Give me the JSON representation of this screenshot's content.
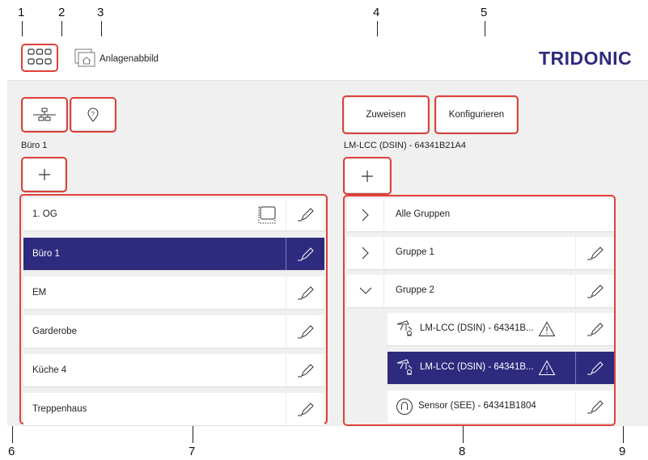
{
  "callouts": [
    "1",
    "2",
    "3",
    "4",
    "5",
    "6",
    "7",
    "8",
    "9"
  ],
  "header": {
    "title": "Anlagenabbild",
    "brand": "TRIDONIC",
    "brand_color": "#2e2a7e",
    "apps_icon": "apps-grid-icon",
    "home_icon": "building-home-icon"
  },
  "left": {
    "network_icon": "network-topology-icon",
    "location_icon": "location-help-icon",
    "context_label": "Büro 1",
    "add_icon": "plus-icon",
    "rows": [
      {
        "label": "1. OG",
        "selected": false
      },
      {
        "label": "Büro 1",
        "selected": true
      },
      {
        "label": "EM",
        "selected": false
      },
      {
        "label": "Garderobe",
        "selected": false
      },
      {
        "label": "Küche 4",
        "selected": false
      },
      {
        "label": "Treppenhaus",
        "selected": false
      }
    ]
  },
  "right": {
    "assign_label": "Zuweisen",
    "configure_label": "Konfigurieren",
    "context_label": "LM-LCC (DSIN) - 64341B21A4",
    "add_icon": "plus-icon",
    "rows": [
      {
        "label": "Alle Gruppen",
        "chevron": "right"
      },
      {
        "label": "Gruppe 1",
        "chevron": "right"
      },
      {
        "label": "Gruppe 2",
        "chevron": "down"
      },
      {
        "label": "LM-LCC (DSIN) - 64341B...",
        "device": true,
        "warning": true,
        "selected": false
      },
      {
        "label": "LM-LCC (DSIN) - 64341B...",
        "device": true,
        "warning": true,
        "selected": true
      },
      {
        "label": "Sensor (SEE) - 64341B1804",
        "sensor": true,
        "selected": false
      }
    ]
  },
  "colors": {
    "selected": "#2e2a7e",
    "callout_border": "#e0413a",
    "panel_bg": "#f0f0f0"
  }
}
